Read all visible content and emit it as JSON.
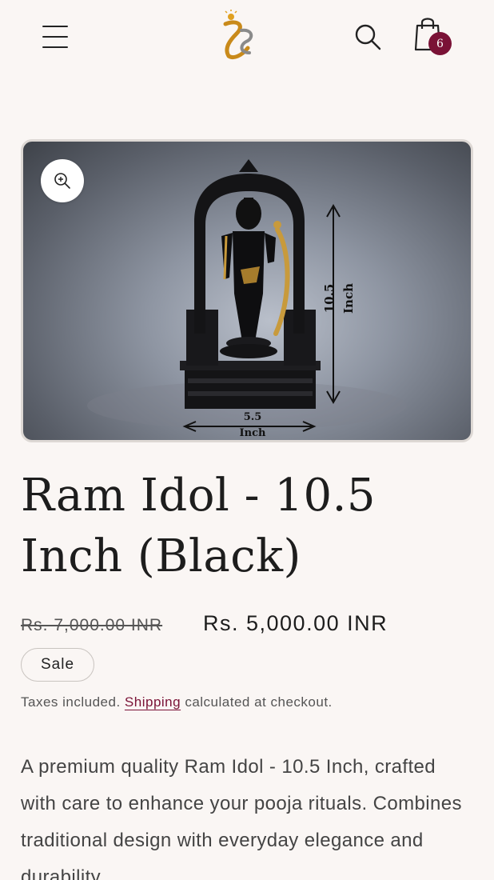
{
  "header": {
    "menu_icon": "hamburger-menu-icon",
    "logo_icon": "brand-logo",
    "search_icon": "search-icon",
    "cart_icon": "shopping-bag-icon",
    "cart_count": "6"
  },
  "product": {
    "title": "Ram Idol - 10.5 Inch (Black)",
    "regular_price": "Rs. 7,000.00 INR",
    "sale_price": "Rs. 5,000.00 INR",
    "sale_badge": "Sale",
    "tax_prefix": "Taxes included.",
    "tax_link": "Shipping",
    "tax_suffix": "calculated at checkout.",
    "description": "A premium quality Ram Idol - 10.5 Inch, crafted with care to enhance your pooja rituals. Combines traditional design with everyday elegance and durability."
  },
  "image": {
    "zoom_icon": "zoom-in-icon",
    "height_value": "10.5",
    "height_unit": "Inch",
    "width_value": "5.5",
    "width_unit": "Inch"
  },
  "colors": {
    "accent": "#7a1236",
    "background": "#faf6f4",
    "text": "#1d1d1d"
  }
}
